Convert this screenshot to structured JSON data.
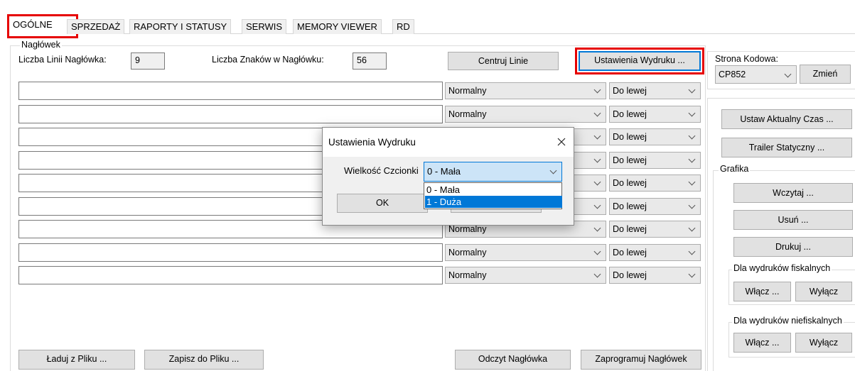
{
  "tabs": [
    "OGÓLNE",
    "SPRZEDAŻ",
    "RAPORTY I STATUSY",
    "SERWIS",
    "MEMORY VIEWER",
    "RD"
  ],
  "header_group": {
    "legend": "Nagłówek",
    "lines_label": "Liczba Linii Nagłówka:",
    "lines_value": "9",
    "chars_label": "Liczba Znaków w Nagłówku:",
    "chars_value": "56",
    "center_button": "Centruj Linie",
    "print_settings_button": "Ustawienia Wydruku ...",
    "rows": [
      {
        "text": "",
        "style": "Normalny",
        "align": "Do lewej"
      },
      {
        "text": "",
        "style": "Normalny",
        "align": "Do lewej"
      },
      {
        "text": "",
        "style": "Normalny",
        "align": "Do lewej"
      },
      {
        "text": "",
        "style": "Normalny",
        "align": "Do lewej"
      },
      {
        "text": "",
        "style": "Normalny",
        "align": "Do lewej"
      },
      {
        "text": "",
        "style": "Normalny",
        "align": "Do lewej"
      },
      {
        "text": "",
        "style": "Normalny",
        "align": "Do lewej"
      },
      {
        "text": "",
        "style": "Normalny",
        "align": "Do lewej"
      },
      {
        "text": "",
        "style": "Normalny",
        "align": "Do lewej"
      }
    ],
    "load_button": "Ładuj z Pliku ...",
    "save_button": "Zapisz do Pliku ...",
    "read_button": "Odczyt Nagłówka",
    "program_button": "Zaprogramuj Nagłówek"
  },
  "codepage": {
    "label": "Strona Kodowa:",
    "value": "CP852",
    "change_button": "Zmień"
  },
  "right_panel": {
    "set_time_button": "Ustaw Aktualny Czas ...",
    "trailer_button": "Trailer Statyczny ...",
    "graphics_legend": "Grafika",
    "load_button": "Wczytaj ...",
    "delete_button": "Usuń ...",
    "print_button": "Drukuj ...",
    "fiscal_legend": "Dla wydruków fiskalnych",
    "fiscal_on": "Włącz ...",
    "fiscal_off": "Wyłącz",
    "nonfiscal_legend": "Dla wydruków niefiskalnych",
    "nonfiscal_on": "Włącz ...",
    "nonfiscal_off": "Wyłącz"
  },
  "dialog": {
    "title": "Ustawienia Wydruku",
    "font_size_label": "Wielkość Czcionki",
    "font_size_value": "0 - Mała",
    "options": [
      "0 - Mała",
      "1 - Duża"
    ],
    "ok_button": "OK"
  },
  "colors": {
    "highlight_box": "#e60000",
    "selection": "#0078d7"
  }
}
